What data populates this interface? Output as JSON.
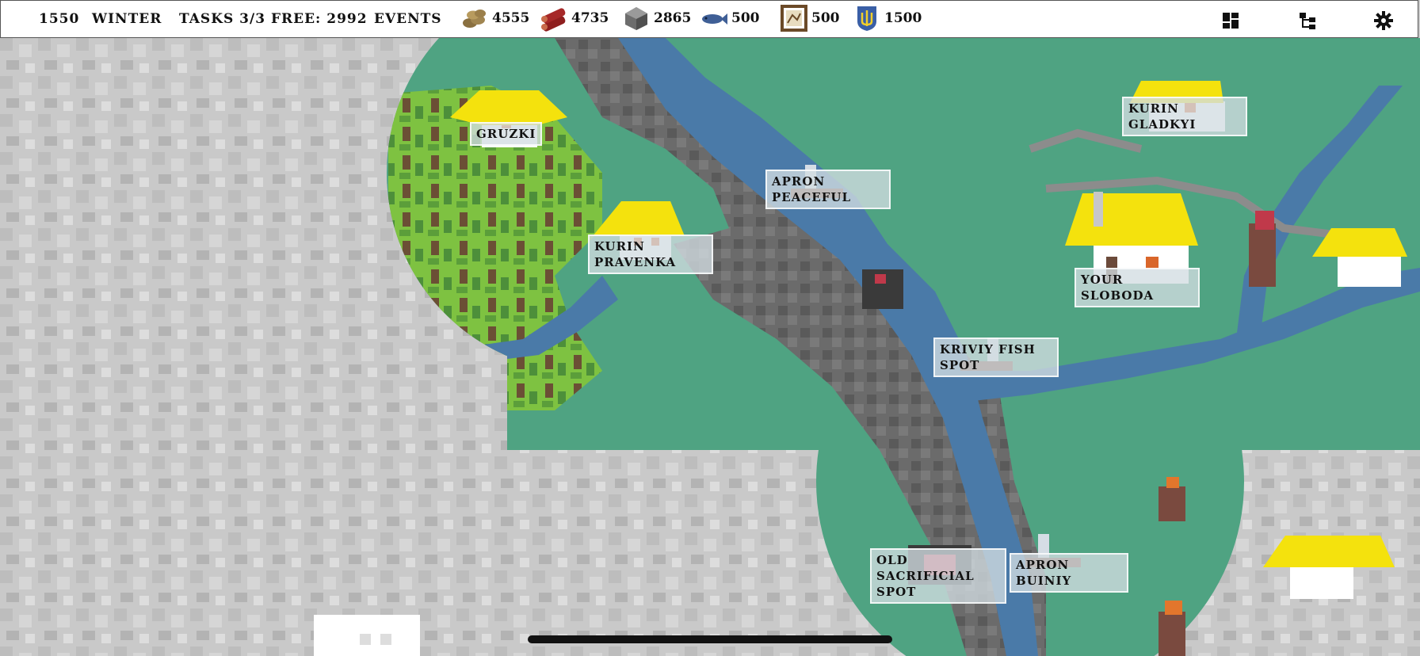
{
  "topbar": {
    "year": "1550",
    "season": "WINTER",
    "tasks": "TASKS 3/3 FREE: 2992",
    "events": "EVENTS",
    "resources": [
      {
        "icon": "coins-icon",
        "value": "4555"
      },
      {
        "icon": "logs-icon",
        "value": "4735"
      },
      {
        "icon": "stone-icon",
        "value": "2865"
      },
      {
        "icon": "fish-icon",
        "value": "500"
      },
      {
        "icon": "map-frame-icon",
        "value": "500"
      },
      {
        "icon": "trident-emblem-icon",
        "value": "1500"
      }
    ],
    "buttons": [
      "layout-grid-icon",
      "hierarchy-icon",
      "gear-icon"
    ]
  },
  "map": {
    "labels": {
      "gruzki": "GRUZKI",
      "apron_peaceful": "APRON\nPEACEFUL",
      "kurin_pravenka": "KURIN\nPRAVENKA",
      "kurin_gladkyi": "KURIN\nGLADKYI",
      "your_sloboda": "YOUR SLOBODA",
      "kriviy_fish_spot": "KRIVIY FISH\nSPOT",
      "old_sacrificial_spot": "OLD\nSACRIFICIAL\nSPOT",
      "apron_buiniy": "APRON BUINIY"
    }
  },
  "colors": {
    "fog": "#c9c9c9",
    "grass": "#4fa382",
    "forest": "#7ec241",
    "water": "#4a7aa8",
    "rock": "#6b6b6b",
    "roof": "#f4e20d"
  }
}
